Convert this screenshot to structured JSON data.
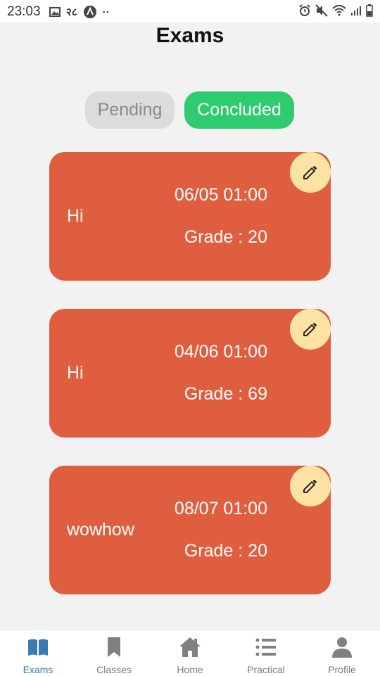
{
  "status_bar": {
    "time": "23:03",
    "network_text": "२८",
    "dots": "··"
  },
  "header": {
    "title": "Exams"
  },
  "tabs": [
    {
      "label": "Pending",
      "active": false
    },
    {
      "label": "Concluded",
      "active": true
    }
  ],
  "exams": [
    {
      "name": "Hi",
      "date": "06/05 01:00",
      "grade": "Grade : 20"
    },
    {
      "name": "Hi",
      "date": "04/06 01:00",
      "grade": "Grade : 69"
    },
    {
      "name": "wowhow",
      "date": "08/07 01:00",
      "grade": "Grade : 20"
    }
  ],
  "bottom_nav": [
    {
      "label": "Exams",
      "icon": "book-open-icon",
      "active": true
    },
    {
      "label": "Classes",
      "icon": "bookmark-icon",
      "active": false
    },
    {
      "label": "Home",
      "icon": "home-icon",
      "active": false
    },
    {
      "label": "Practical",
      "icon": "list-icon",
      "active": false
    },
    {
      "label": "Profile",
      "icon": "user-icon",
      "active": false
    }
  ],
  "colors": {
    "card": "#e05e40",
    "edit_button": "#fde3a3",
    "tab_active": "#2ecc6f",
    "tab_inactive": "#dcdcdc",
    "nav_active": "#3a7ab5",
    "nav_inactive": "#7a7a7a"
  }
}
